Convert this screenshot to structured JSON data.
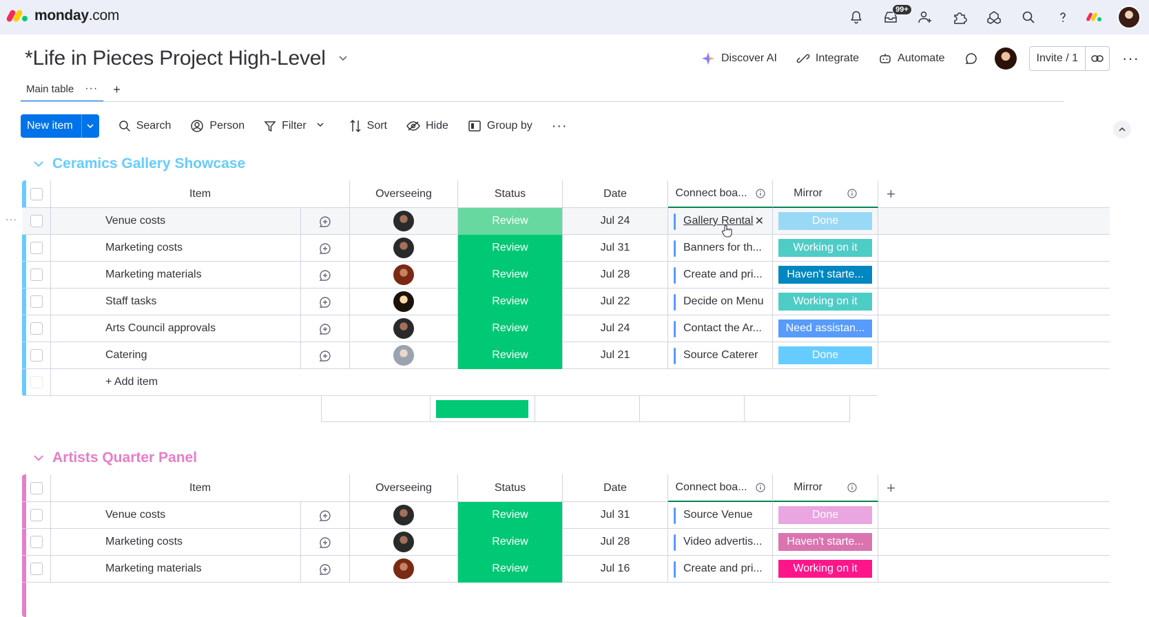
{
  "app": {
    "logo_text": "monday",
    "logo_domain": ".com",
    "notifications_badge": "99+"
  },
  "board": {
    "title": "*Life in Pieces Project High-Level",
    "discover_ai": "Discover AI",
    "integrate": "Integrate",
    "automate": "Automate",
    "invite": "Invite / 1"
  },
  "tabs": {
    "main_table": "Main table"
  },
  "toolbar": {
    "new_item": "New item",
    "search": "Search",
    "person": "Person",
    "filter": "Filter",
    "sort": "Sort",
    "hide": "Hide",
    "group_by": "Group by"
  },
  "columns": {
    "item": "Item",
    "overseeing": "Overseeing",
    "status": "Status",
    "date": "Date",
    "connect": "Connect boa...",
    "mirror": "Mirror"
  },
  "colors": {
    "green": "#00c875",
    "group1": "#66ccff",
    "group2": "#e2445c",
    "pink_group": "#e67ec8"
  },
  "groups": [
    {
      "title": "Ceramics Gallery Showcase",
      "color": "#66ccff",
      "add_item": "+ Add item",
      "rows": [
        {
          "item": "Venue costs",
          "status": "Review",
          "date": "Jul 24",
          "connect": "Gallery Rental",
          "mirror": "Done",
          "mirror_color": "#9ad9f5",
          "avatar": "av1"
        },
        {
          "item": "Marketing costs",
          "status": "Review",
          "date": "Jul 31",
          "connect": "Banners for th...",
          "mirror": "Working on it",
          "mirror_color": "#4eccc6",
          "avatar": "av1"
        },
        {
          "item": "Marketing materials",
          "status": "Review",
          "date": "Jul 28",
          "connect": "Create and pri...",
          "mirror": "Haven't starte...",
          "mirror_color": "#0086c0",
          "avatar": "av2"
        },
        {
          "item": "Staff tasks",
          "status": "Review",
          "date": "Jul 22",
          "connect": "Decide on Menu",
          "mirror": "Working on it",
          "mirror_color": "#4eccc6",
          "avatar": "av3"
        },
        {
          "item": "Arts Council approvals",
          "status": "Review",
          "date": "Jul 24",
          "connect": "Contact the Ar...",
          "mirror": "Need assistan...",
          "mirror_color": "#579bfc",
          "avatar": "av1"
        },
        {
          "item": "Catering",
          "status": "Review",
          "date": "Jul 21",
          "connect": "Source Caterer",
          "mirror": "Done",
          "mirror_color": "#66ccff",
          "avatar": "av4"
        }
      ]
    },
    {
      "title": "Artists Quarter Panel",
      "color": "#e67ec8",
      "rows": [
        {
          "item": "Venue costs",
          "status": "Review",
          "date": "Jul 31",
          "connect": "Source Venue",
          "mirror": "Done",
          "mirror_color": "#e9a6e0",
          "avatar": "av1"
        },
        {
          "item": "Marketing costs",
          "status": "Review",
          "date": "Jul 28",
          "connect": "Video advertis...",
          "mirror": "Haven't starte...",
          "mirror_color": "#d974b0",
          "avatar": "av1"
        },
        {
          "item": "Marketing materials",
          "status": "Review",
          "date": "Jul 16",
          "connect": "Create and pri...",
          "mirror": "Working on it",
          "mirror_color": "#ff158a",
          "avatar": "av2"
        }
      ]
    }
  ]
}
